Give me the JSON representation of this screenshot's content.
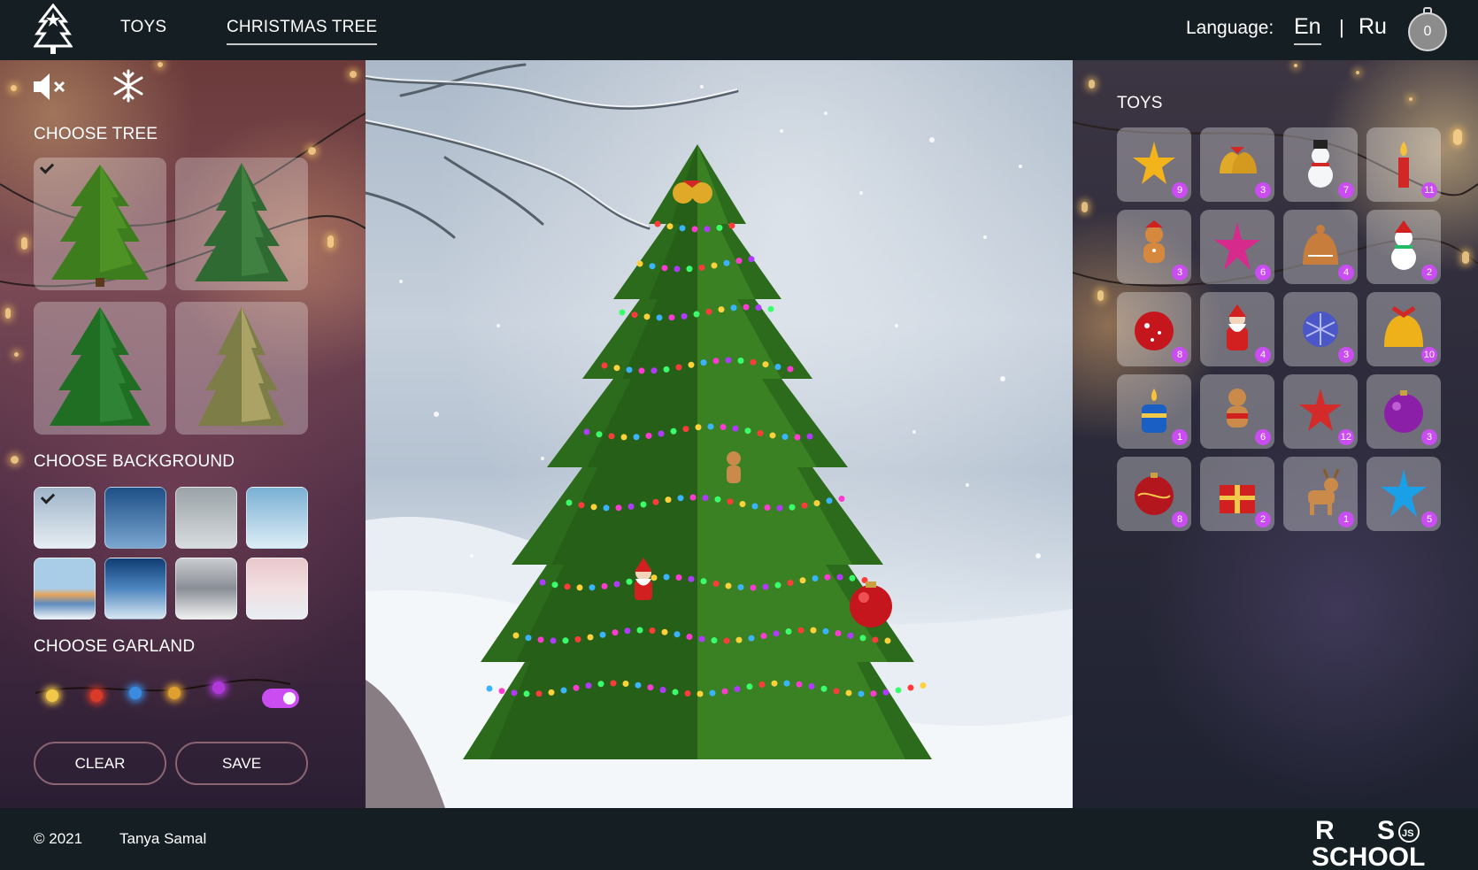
{
  "header": {
    "nav": {
      "toys": "TOYS",
      "tree": "CHRISTMAS TREE"
    },
    "language_label": "Language:",
    "lang_en": "En",
    "lang_sep": "|",
    "lang_ru": "Ru",
    "selected_count": "0"
  },
  "left": {
    "choose_tree": "CHOOSE TREE",
    "choose_background": "CHOOSE BACKGROUND",
    "choose_garland": "CHOOSE GARLAND",
    "clear": "CLEAR",
    "save": "SAVE",
    "garland_colors": [
      "#f2c84a",
      "#d93a2a",
      "#3a8be0",
      "#e0a030",
      "#b03ad8"
    ]
  },
  "toys": {
    "title": "TOYS",
    "items": [
      {
        "icon": "gold-star-icon",
        "count": "9"
      },
      {
        "icon": "bells-icon",
        "count": "3"
      },
      {
        "icon": "snowman-blue-icon",
        "count": "7"
      },
      {
        "icon": "candle-icon",
        "count": "11"
      },
      {
        "icon": "gingerbread-man-icon",
        "count": "3"
      },
      {
        "icon": "pink-star-icon",
        "count": "6"
      },
      {
        "icon": "gingerbread-bell-icon",
        "count": "4"
      },
      {
        "icon": "snowman-icon",
        "count": "2"
      },
      {
        "icon": "red-ball-icon",
        "count": "8"
      },
      {
        "icon": "santa-icon",
        "count": "4"
      },
      {
        "icon": "blue-snowflake-icon",
        "count": "3"
      },
      {
        "icon": "golden-bell-icon",
        "count": "10"
      },
      {
        "icon": "blue-candle-icon",
        "count": "1"
      },
      {
        "icon": "gingerbread-figure-icon",
        "count": "6"
      },
      {
        "icon": "red-star-icon",
        "count": "12"
      },
      {
        "icon": "purple-ball-icon",
        "count": "3"
      },
      {
        "icon": "ornate-red-ball-icon",
        "count": "8"
      },
      {
        "icon": "gift-box-icon",
        "count": "2"
      },
      {
        "icon": "deer-icon",
        "count": "1"
      },
      {
        "icon": "blue-star-icon",
        "count": "5"
      }
    ]
  },
  "footer": {
    "copyright": "© 2021",
    "author": "Tanya Samal",
    "school_logo_lines": [
      "RS",
      "SCHOOL",
      "JS"
    ]
  },
  "colors": {
    "accent": "#c94df0",
    "header_bg": "#151e22"
  }
}
